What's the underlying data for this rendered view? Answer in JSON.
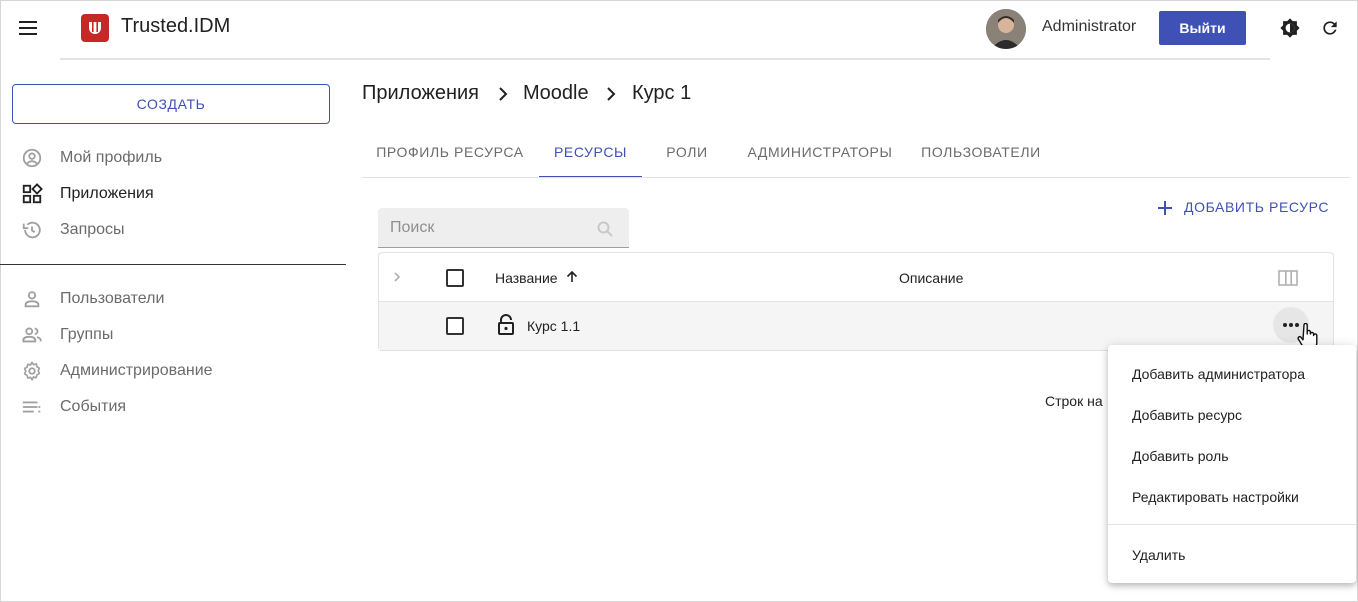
{
  "header": {
    "brand": "Trusted.IDM",
    "user_name": "Administrator",
    "logout_label": "Выйти"
  },
  "sidebar": {
    "create_label": "СОЗДАТЬ",
    "items": [
      {
        "label": "Мой профиль",
        "icon": "account-circle-icon"
      },
      {
        "label": "Приложения",
        "icon": "apps-icon"
      },
      {
        "label": "Запросы",
        "icon": "history-icon"
      },
      {
        "label": "Пользователи",
        "icon": "person-icon"
      },
      {
        "label": "Группы",
        "icon": "group-icon"
      },
      {
        "label": "Администрирование",
        "icon": "gear-icon"
      },
      {
        "label": "События",
        "icon": "list-icon"
      }
    ]
  },
  "breadcrumb": [
    "Приложения",
    "Moodle",
    "Курс 1"
  ],
  "tabs": [
    "ПРОФИЛЬ РЕСУРСА",
    "РЕСУРСЫ",
    "РОЛИ",
    "АДМИНИСТРАТОРЫ",
    "ПОЛЬЗОВАТЕЛИ"
  ],
  "active_tab": "РЕСУРСЫ",
  "toolbar": {
    "add_resource_label": "ДОБАВИТЬ РЕСУРС",
    "search_placeholder": "Поиск"
  },
  "table": {
    "columns": [
      "Название",
      "Описание"
    ],
    "rows": [
      {
        "name": "Курс 1.1",
        "description": ""
      }
    ]
  },
  "pagination": {
    "rows_per_page_label": "Строк на"
  },
  "context_menu": {
    "items": [
      "Добавить администратора",
      "Добавить ресурс",
      "Добавить роль",
      "Редактировать настройки"
    ],
    "danger_item": "Удалить"
  },
  "colors": {
    "accent": "#3f51b5",
    "brand": "#c62828",
    "muted_text": "#6b6b6b"
  }
}
